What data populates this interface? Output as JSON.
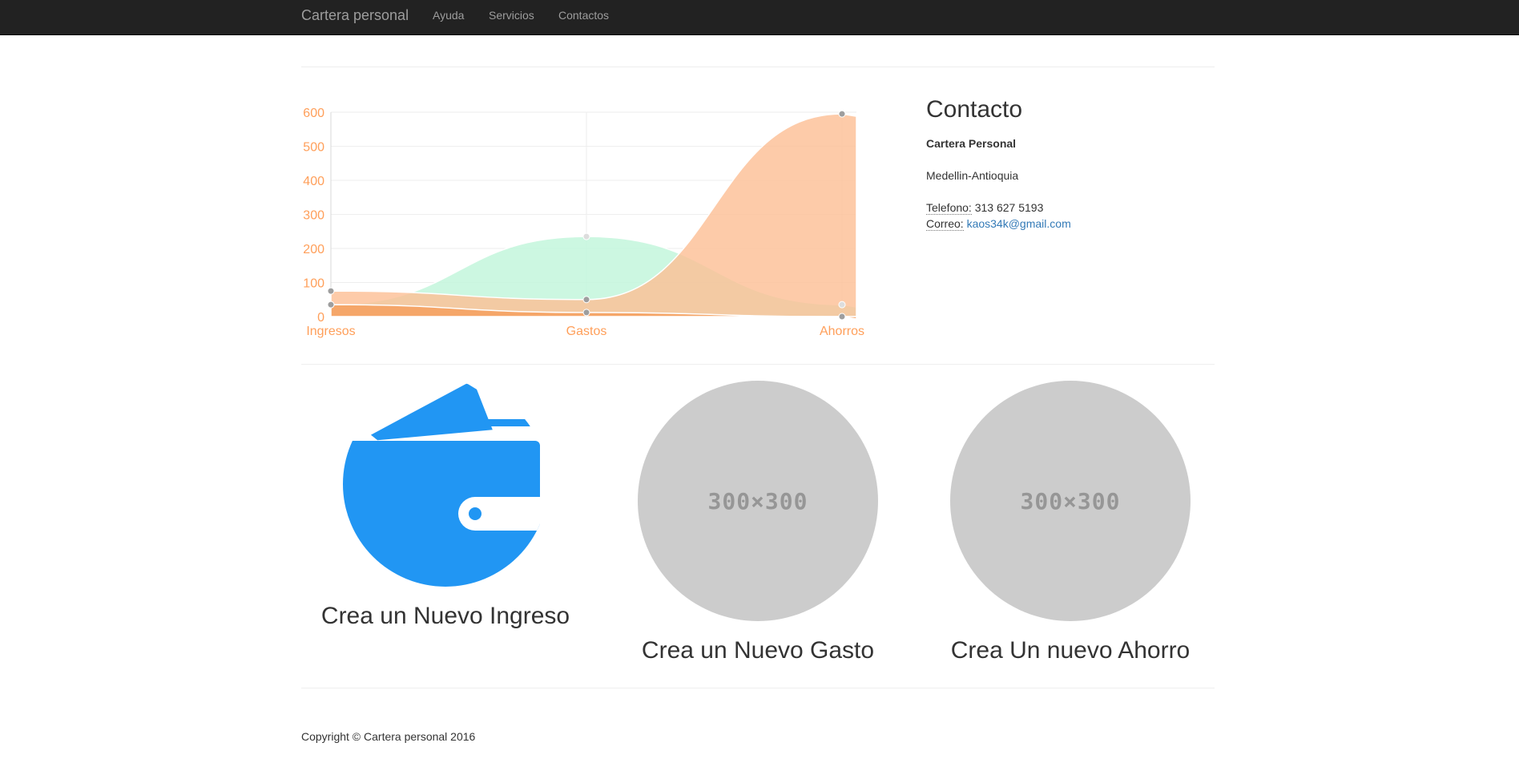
{
  "navbar": {
    "brand": "Cartera personal",
    "links": [
      "Ayuda",
      "Servicios",
      "Contactos"
    ]
  },
  "colors": {
    "navbar_bg": "#222222",
    "series_ingresos": "#bff5d9",
    "series_gastos": "#fdbe94",
    "series_ahorros": "#f5a05f",
    "tick_color": "#ff9f5a",
    "wallet_blue": "#2196f3",
    "placeholder_gray": "#cccccc"
  },
  "chart_data": {
    "type": "area",
    "categories": [
      "Ingresos",
      "Gastos",
      "Ahorros"
    ],
    "ylim": [
      0,
      600
    ],
    "yticks": [
      0,
      100,
      200,
      300,
      400,
      500,
      600
    ],
    "grid": true,
    "series": [
      {
        "values": [
          35,
          235,
          35
        ],
        "color": "#bff5d9"
      },
      {
        "values": [
          75,
          50,
          595
        ],
        "color": "#fdbe94"
      },
      {
        "values": [
          35,
          12,
          0
        ],
        "color": "#f5a05f"
      }
    ]
  },
  "contact": {
    "heading": "Contacto",
    "name": "Cartera Personal",
    "city": "Medellin-Antioquia",
    "phone_label": "Telefono:",
    "phone": "313 627 5193",
    "email_label": "Correo:",
    "email": "kaos34k@gmail.com"
  },
  "cards": [
    {
      "title": "Crea un Nuevo Ingreso",
      "icon": "wallet-icon"
    },
    {
      "title": "Crea un Nuevo Gasto",
      "placeholder": "300×300"
    },
    {
      "title": "Crea Un nuevo Ahorro",
      "placeholder": "300×300"
    }
  ],
  "footer": {
    "copyright": "Copyright © Cartera personal 2016"
  }
}
